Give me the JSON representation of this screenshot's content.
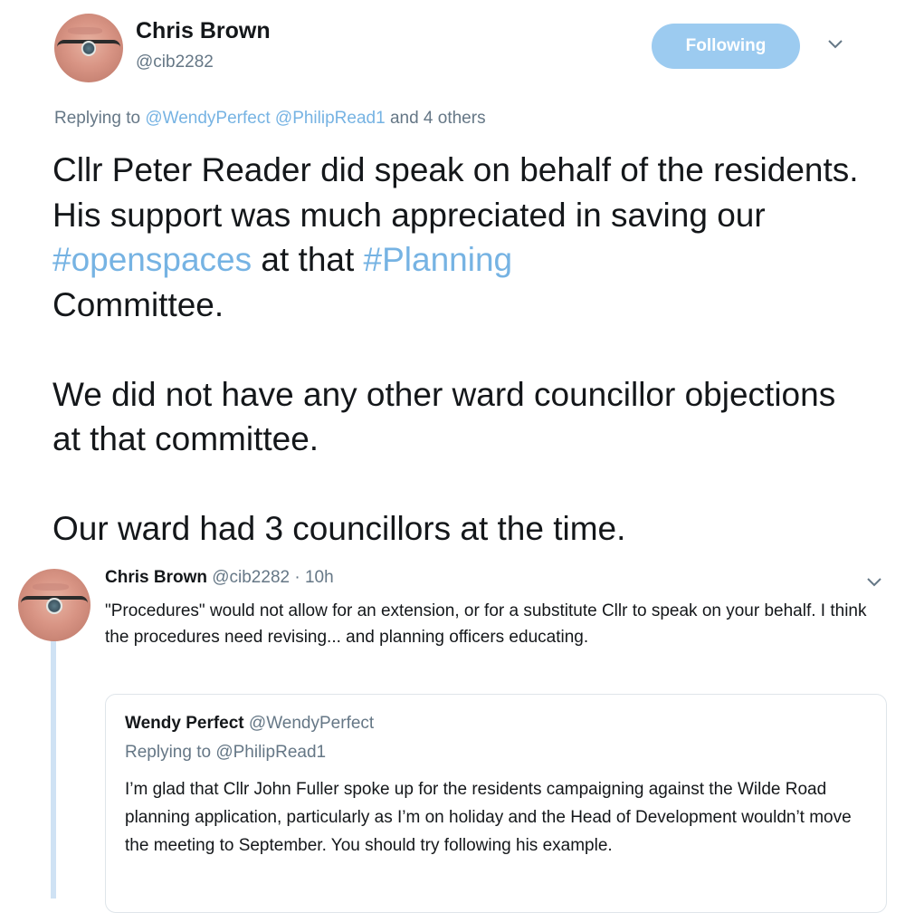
{
  "main_tweet": {
    "author_name": "Chris Brown",
    "author_handle": "@cib2282",
    "follow_button": "Following",
    "replying_prefix": "Replying to",
    "replying_mentions": [
      "@WendyPerfect",
      "@PhilipRead1"
    ],
    "replying_others": "and 4 others",
    "para1_a": "Cllr Peter Reader did speak on behalf of the residents.  His support was much appreciated in saving our ",
    "hashtag1": "#openspaces",
    "para1_b": " at that ",
    "hashtag2": "#Planning",
    "para1_c": " Committee.",
    "para2": "We did not have any other ward councillor objections at that committee.",
    "para3": "Our ward had 3 councillors at the time."
  },
  "reply_tweet": {
    "author_name": "Chris Brown",
    "author_handle": "@cib2282",
    "separator": "·",
    "time": "10h",
    "text": "\"Procedures\" would not allow for an extension, or for a substitute Cllr to speak on your behalf. I think the procedures need revising... and planning officers educating."
  },
  "quoted_tweet": {
    "author_name": "Wendy Perfect",
    "author_handle": "@WendyPerfect",
    "replying_to": "Replying to @PhilipRead1",
    "text": "I’m glad that Cllr John Fuller spoke up for the residents campaigning against the Wilde Road planning application, particularly as I’m on holiday and the Head of Development wouldn’t move the meeting to September. You should try following his example."
  },
  "colors": {
    "link": "#76b3e3",
    "follow_bg": "#9ccbf0",
    "secondary_text": "#657786",
    "thread_line": "#cfe2f4"
  },
  "icons": [
    "chevron-down-icon",
    "avatar"
  ]
}
